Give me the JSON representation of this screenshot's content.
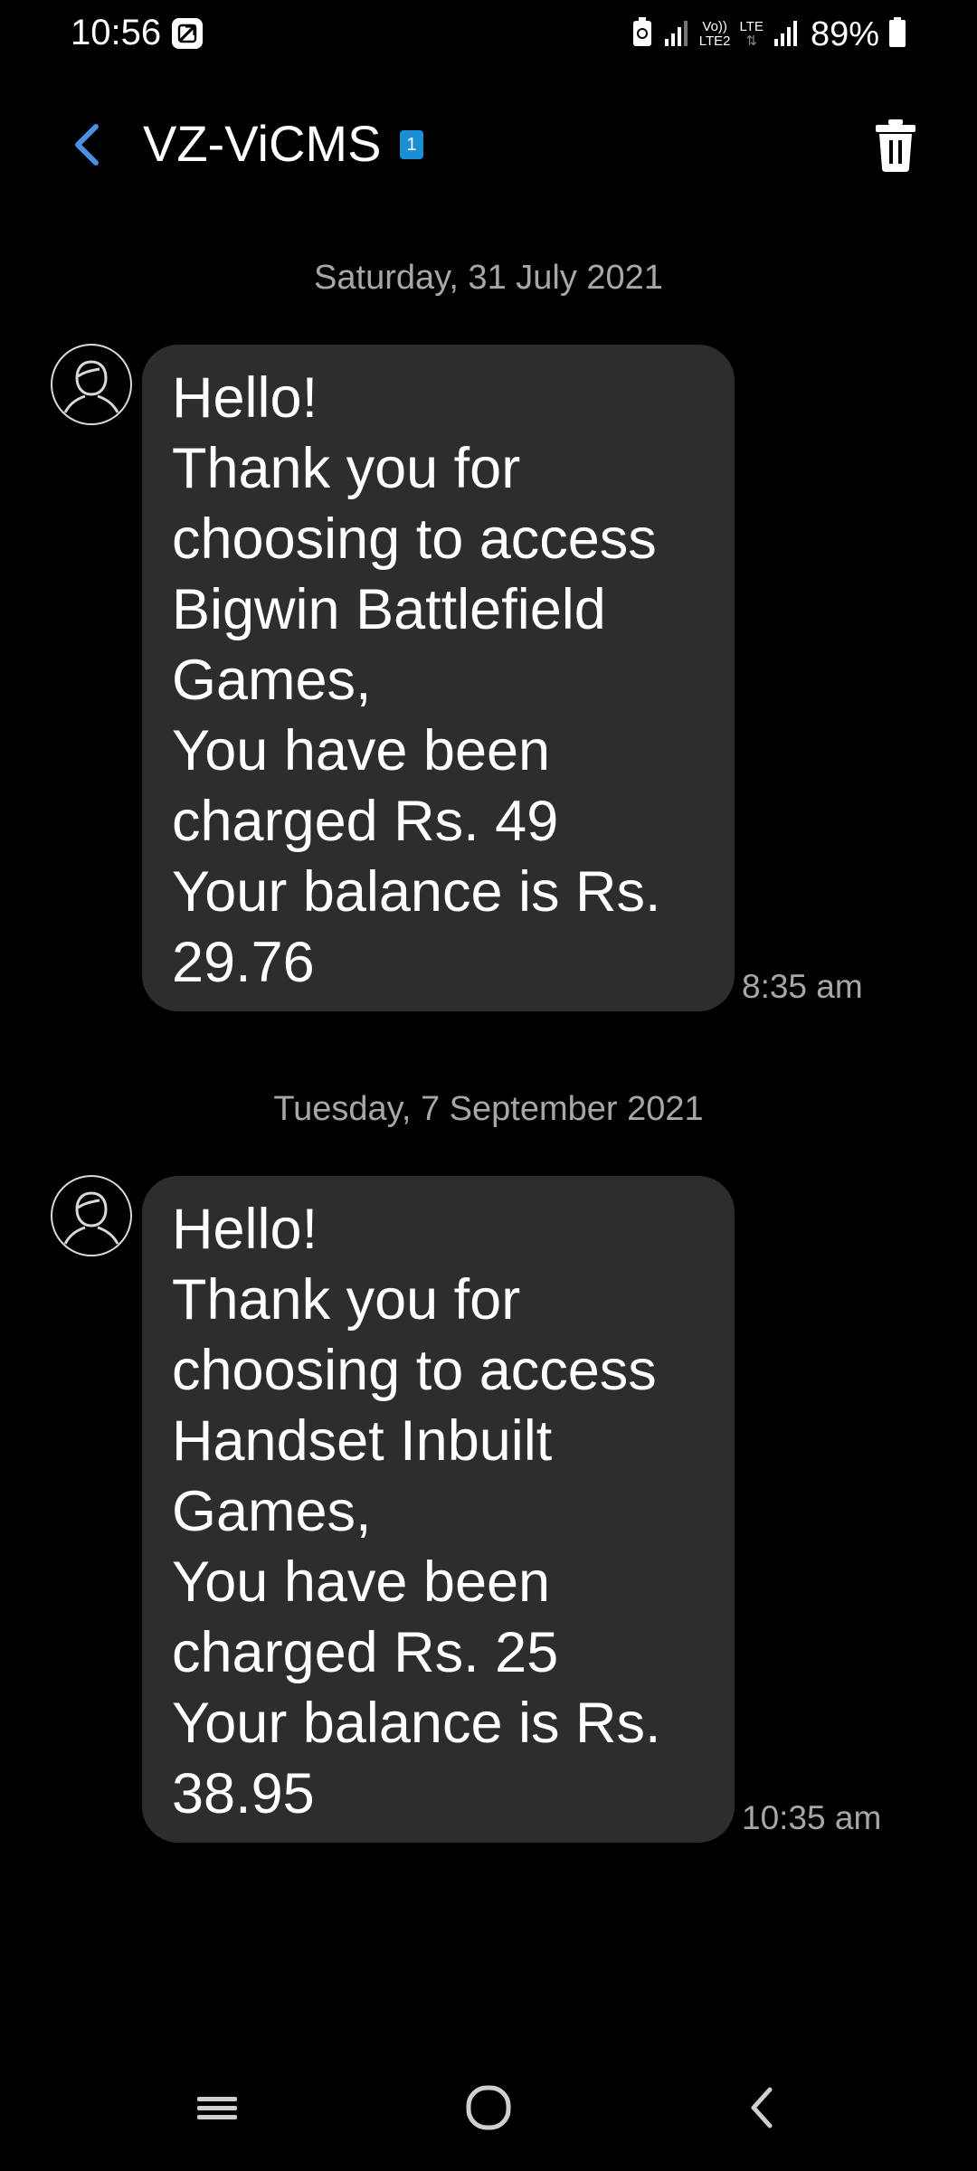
{
  "status_bar": {
    "time": "10:56",
    "network_label_top": "Vo))",
    "network_label_bottom": "LTE2",
    "lte_label": "LTE",
    "battery": "89%"
  },
  "header": {
    "title": "VZ-ViCMS",
    "sim_badge": "1"
  },
  "messages": [
    {
      "date": "Saturday, 31 July 2021",
      "text": "Hello!\nThank you for choosing to access Bigwin Battlefield Games,\nYou have been charged Rs. 49\nYour balance is Rs. 29.76",
      "time": "8:35 am"
    },
    {
      "date": "Tuesday, 7 September 2021",
      "text": "Hello!\nThank you for choosing to access Handset Inbuilt Games,\nYou have been charged Rs. 25\nYour balance is Rs. 38.95",
      "time": "10:35 am"
    }
  ],
  "colors": {
    "background": "#000000",
    "bubble": "#2d2d2d",
    "accent": "#4a90e2",
    "secondary_text": "#a7a7a7"
  },
  "icons": {
    "back": "chevron-left-icon",
    "delete": "trash-icon",
    "avatar": "person-icon",
    "nav_recents": "recents-icon",
    "nav_home": "home-icon",
    "nav_back": "back-icon"
  }
}
